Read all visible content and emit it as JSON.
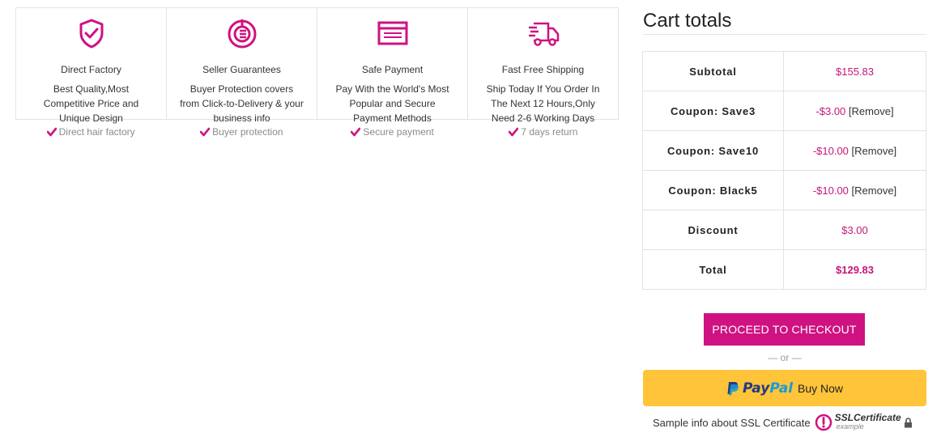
{
  "features": [
    {
      "icon": "shield-check-icon",
      "title": "Direct Factory",
      "desc": [
        "Best Quality,Most",
        "Competitive Price and",
        "Unique Design"
      ]
    },
    {
      "icon": "guarantee-icon",
      "title": "Seller Guarantees",
      "desc": [
        "Buyer Protection covers",
        "from Click-to-Delivery & your",
        "business info"
      ]
    },
    {
      "icon": "credit-card-icon",
      "title": "Safe Payment",
      "desc": [
        "Pay With the World's Most",
        "Popular and Secure",
        "Payment Methods"
      ]
    },
    {
      "icon": "delivery-truck-icon",
      "title": "Fast Free Shipping",
      "desc": [
        "Ship Today If You Order In",
        "The Next 12 Hours,Only",
        "Need 2-6 Working Days"
      ]
    }
  ],
  "checks": [
    "Direct hair factory",
    "Buyer protection",
    "Secure payment",
    "7 days return"
  ],
  "cart": {
    "title": "Cart totals",
    "rows": [
      {
        "label": "Subtotal",
        "value": "$155.83",
        "remove": ""
      },
      {
        "label": "Coupon: Save3",
        "value": "-$3.00",
        "remove": "[Remove]"
      },
      {
        "label": "Coupon: Save10",
        "value": "-$10.00",
        "remove": "[Remove]"
      },
      {
        "label": "Coupon: Black5",
        "value": "-$10.00",
        "remove": "[Remove]"
      },
      {
        "label": "Discount",
        "value": "$3.00",
        "remove": ""
      },
      {
        "label": "Total",
        "value": "$129.83",
        "remove": ""
      }
    ],
    "checkout_label": "PROCEED TO CHECKOUT",
    "or_label": "— or —",
    "paypal": {
      "pay": "Pay",
      "pal": "Pal",
      "buy_now": "Buy Now"
    },
    "ssl": {
      "text": "Sample info about SSL Certificate",
      "brand": "SSLCertificate",
      "sub": "example"
    }
  },
  "colors": {
    "accent": "#cf1281",
    "price": "#c7157a",
    "paypal_yellow": "#ffc439",
    "paypal_dark": "#253b80",
    "paypal_light": "#179bd7"
  }
}
